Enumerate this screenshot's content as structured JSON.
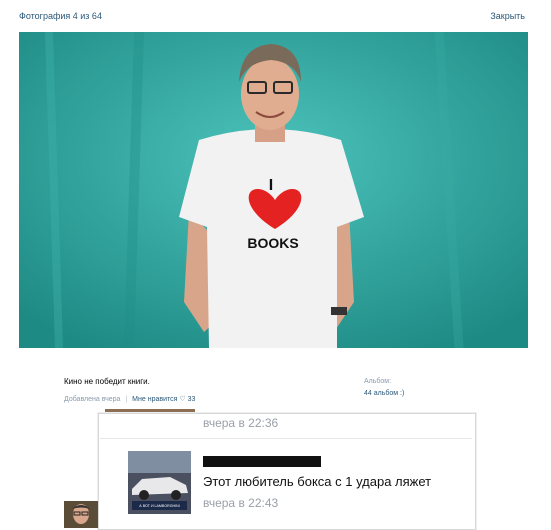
{
  "topbar": {
    "title": "Фотография 4 из 64",
    "close_label": "Закрыть"
  },
  "photo": {
    "shirt_top": "I",
    "shirt_bottom": "BOOKS",
    "shirt_heart": "heart"
  },
  "footer": {
    "description": "Кино не победит книги.",
    "added": "Добавлена вчера",
    "like": "Мне нравится",
    "like_count": "33",
    "album_label": "Альбом:",
    "album_value": "44 альбом :)"
  },
  "comments": {
    "first_time": "вчера в 22:36",
    "text": "Этот любитель бокса с 1 удара ляжет",
    "second_time": "вчера в 22:43",
    "thumb_caption": "А ВОТ И LAMBORGHINI"
  },
  "colors": {
    "link": "#2b587a",
    "muted": "#8a9ab0",
    "backdrop": "#2aa39c",
    "heart": "#e52222"
  }
}
